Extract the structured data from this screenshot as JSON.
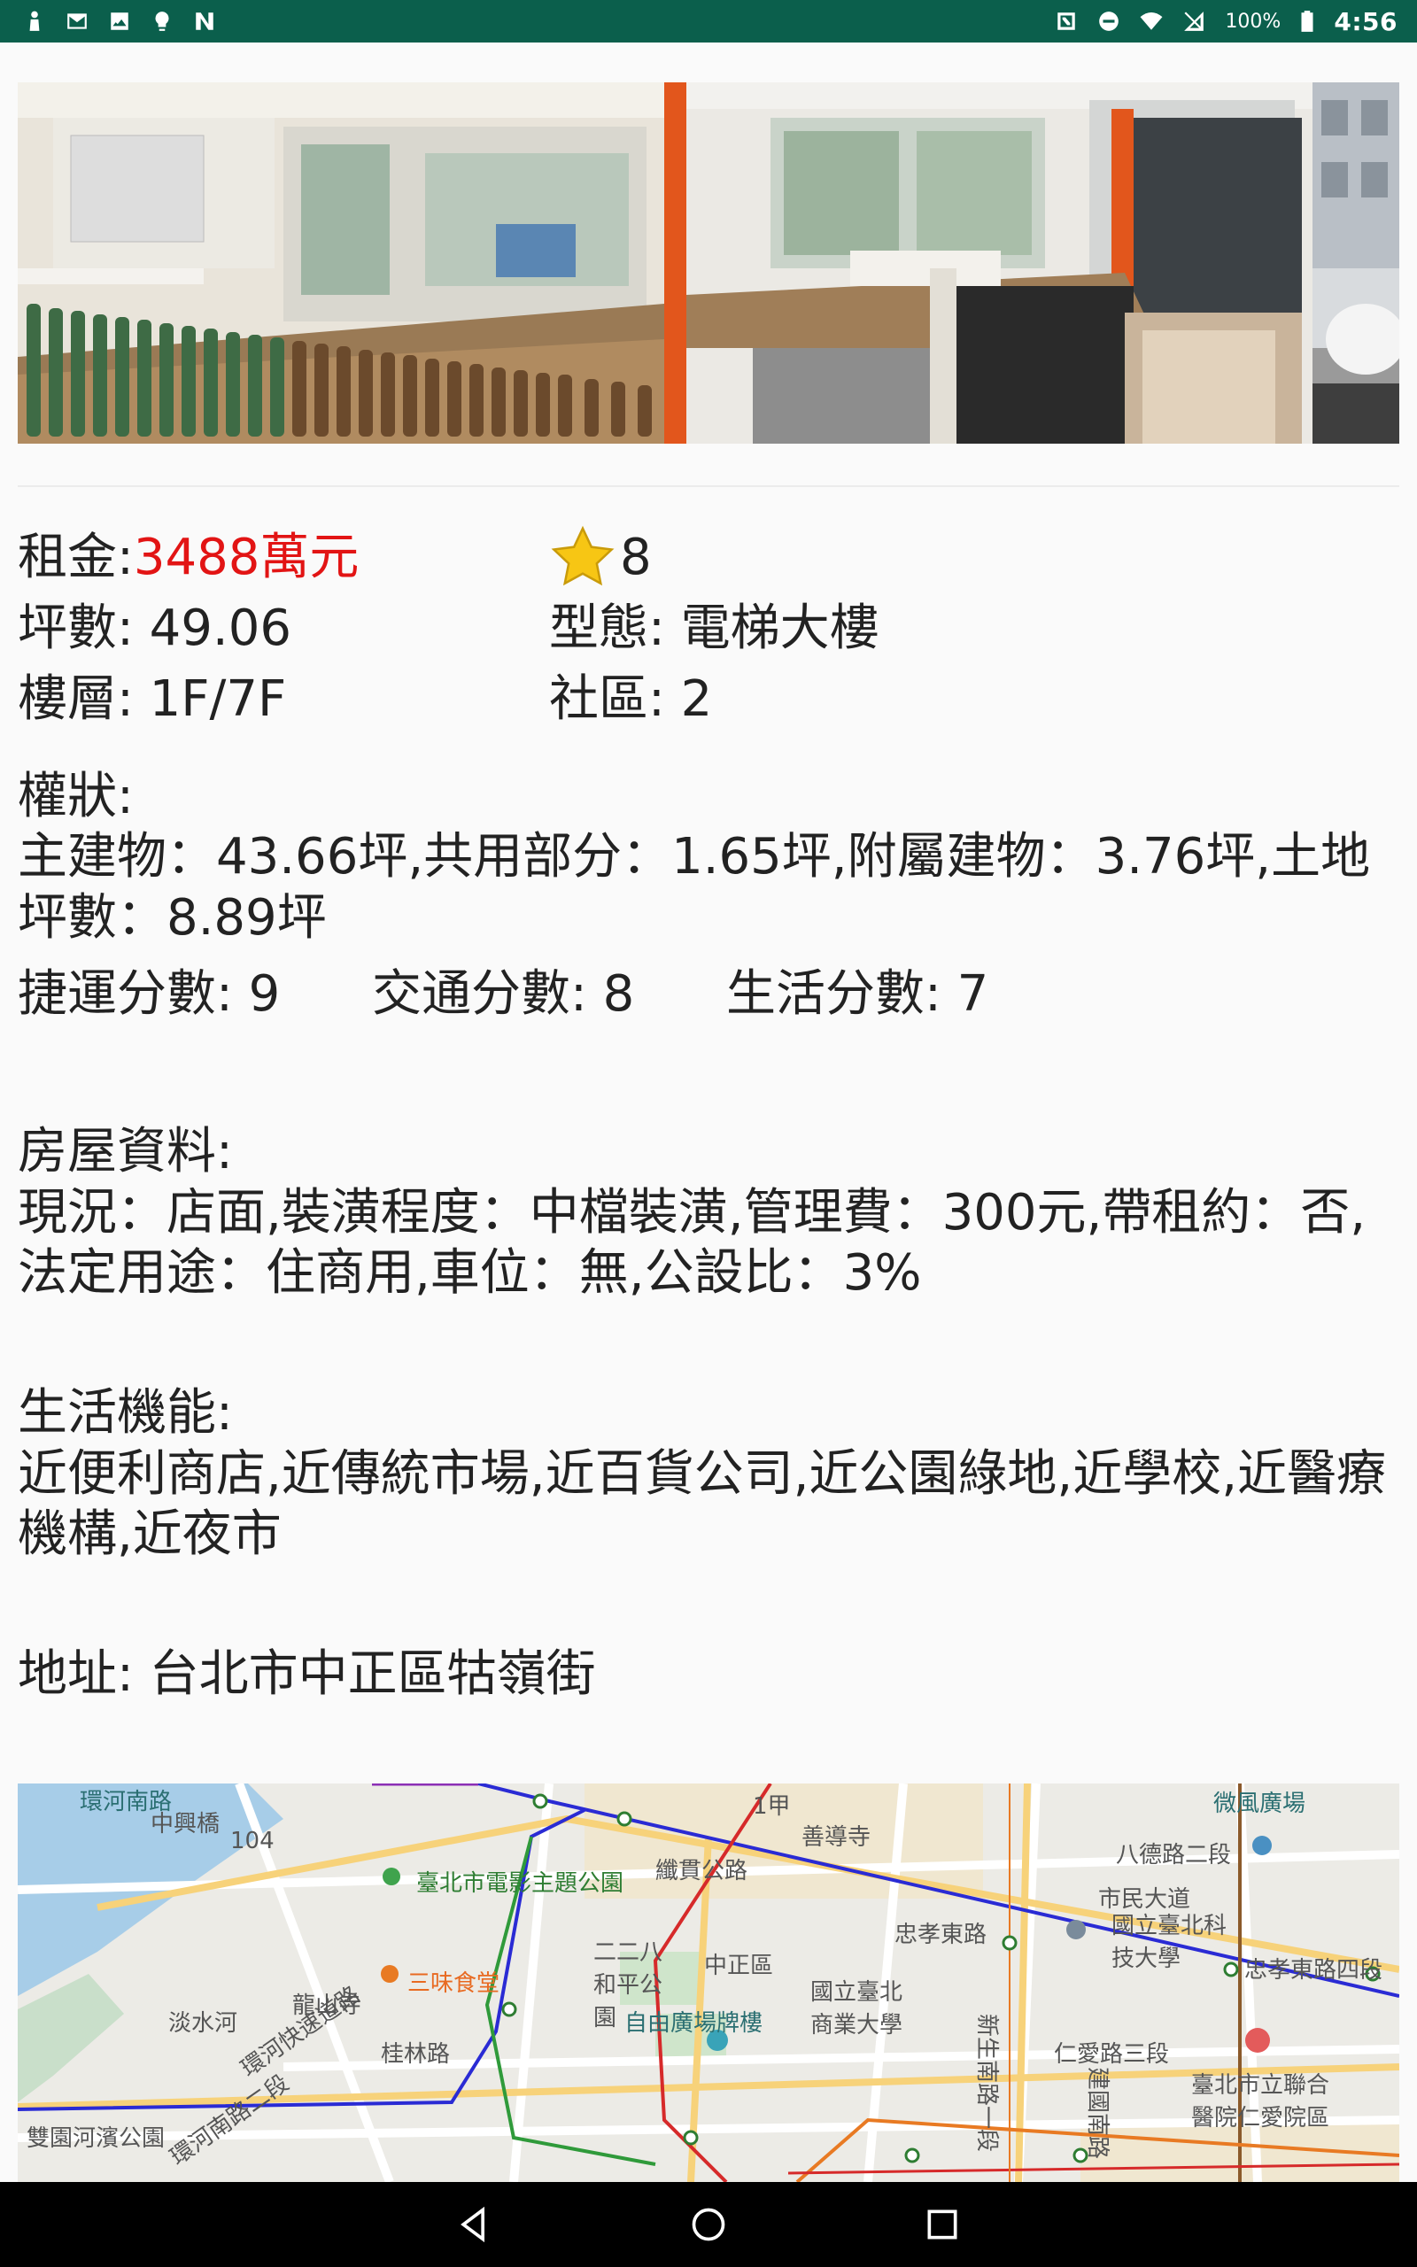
{
  "status_bar": {
    "battery_text": "100%",
    "time": "4:56",
    "icons_left": [
      "person-icon",
      "mail-icon",
      "image-icon",
      "bulb-icon",
      "nfc-app-icon"
    ],
    "icons_right": [
      "nfc-icon",
      "dnd-icon",
      "wifi-icon",
      "signal-icon"
    ]
  },
  "listing": {
    "rent_label": "租金:",
    "rent_value": "3488萬元",
    "rating_value": "8",
    "area_text": "坪數: 49.06",
    "type_text": "型態: 電梯大樓",
    "floor_text": "樓層: 1F/7F",
    "community_text": "社區: 2",
    "ownership_title": "權狀:",
    "ownership_body": "主建物：43.66坪,共用部分：1.65坪,附屬建物：3.76坪,土地坪數：8.89坪",
    "mrt_score": "捷運分數: 9",
    "traffic_score": "交通分數: 8",
    "life_score": "生活分數: 7",
    "house_title": "房屋資料:",
    "house_body": "現況：店面,裝潢程度：中檔裝潢,管理費：300元,帶租約：否,法定用途：住商用,車位：無,公設比：3%",
    "amenity_title": "生活機能:",
    "amenity_body": "近便利商店,近傳統市場,近百貨公司,近公園綠地,近學校,近醫療機構,近夜市",
    "address_text": "地址: 台北市中正區牯嶺街"
  },
  "map": {
    "labels": {
      "l1": "環河南路",
      "l2": "中興橋",
      "l3": "104",
      "l4": "臺北市電影主題公園",
      "l5": "1甲",
      "l6": "善導寺",
      "l7": "微風廣場",
      "l8": "八德路二段",
      "l9": "纖貫公路",
      "l10": "忠孝東路",
      "l11": "市民大道",
      "l12": "國立臺北科技大學",
      "l13": "忠孝東路四段",
      "l14": "二二八和平公園",
      "l15": "中正區",
      "l16": "國立臺北商業大學",
      "l17": "三味食堂",
      "l18": "龍山寺",
      "l19": "環河快速道路",
      "l20": "淡水河",
      "l21": "桂林路",
      "l22": "自由廣場牌樓",
      "l23": "新生南路一段",
      "l24": "仁愛路三段",
      "l25": "臺北市立聯合醫院仁愛院區",
      "l26": "雙園河濱公園",
      "l27": "環河南路二段",
      "l28": "建國南路"
    }
  },
  "nav_bar": {
    "buttons": [
      "back-icon",
      "home-icon",
      "recents-icon"
    ]
  }
}
